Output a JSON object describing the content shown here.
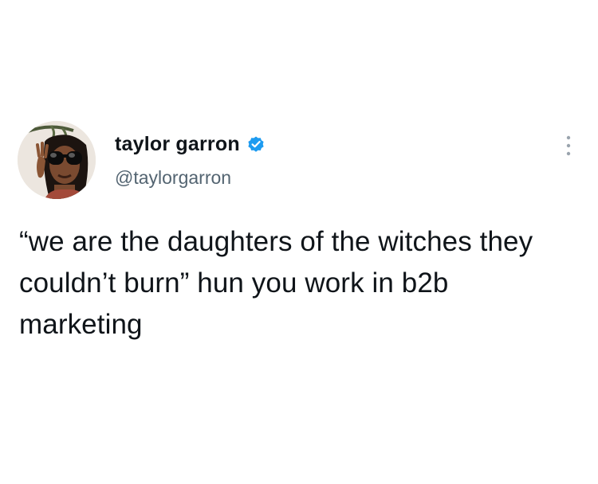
{
  "tweet": {
    "author": {
      "display_name": "taylor garron",
      "handle": "@taylorgarron",
      "verified": true,
      "avatar_icon": "profile-photo"
    },
    "text": "“we are the daughters of the witches they couldn’t burn” hun you work in b2b marketing",
    "more_icon": "more-options-icon"
  },
  "colors": {
    "text_primary": "#0f1419",
    "text_secondary": "#536471",
    "verified_blue": "#1d9bf0",
    "background": "#ffffff"
  }
}
